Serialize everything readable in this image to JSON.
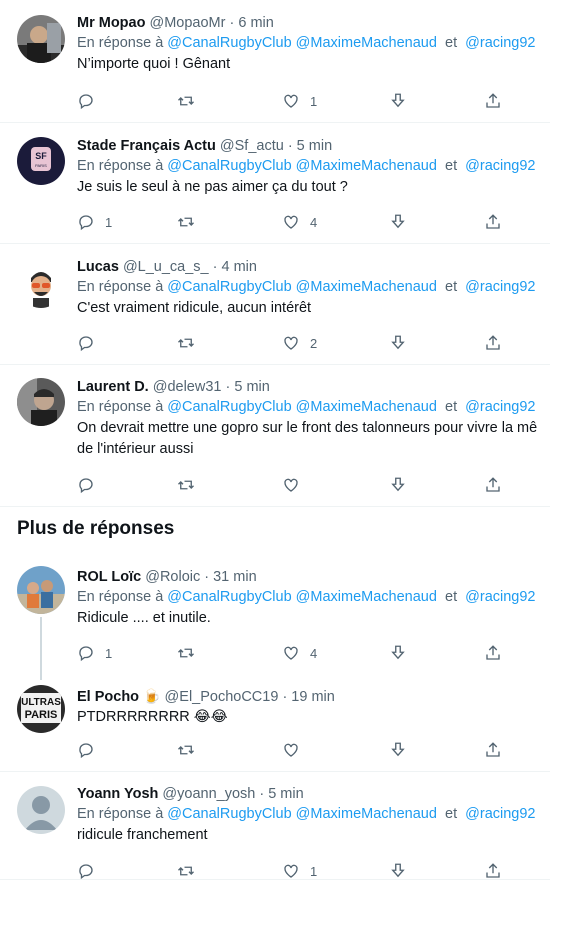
{
  "reply_prefix": "En réponse à",
  "and_word": "et",
  "section_title": "Plus de réponses",
  "tweets": [
    {
      "name": "Mr Mopao",
      "handle": "@MopaoMr",
      "time": "· 6 min",
      "mentions": [
        "@CanalRugbyClub",
        "@MaximeMachenaud",
        "@racing92"
      ],
      "lines": [
        "N’importe quoi ! Gênant"
      ],
      "replies": "",
      "retweets": "",
      "likes": "1"
    },
    {
      "name": "Stade Français Actu",
      "handle": "@Sf_actu",
      "time": "· 5 min",
      "mentions": [
        "@CanalRugbyClub",
        "@MaximeMachenaud",
        "@racing92"
      ],
      "lines": [
        "Je suis le seul à ne pas aimer ça du tout ?"
      ],
      "replies": "1",
      "retweets": "",
      "likes": "4"
    },
    {
      "name": "Lucas",
      "handle": "@L_u_ca_s_",
      "time": "· 4 min",
      "mentions": [
        "@CanalRugbyClub",
        "@MaximeMachenaud",
        "@racing92"
      ],
      "lines": [
        "C'est vraiment ridicule, aucun intérêt"
      ],
      "replies": "",
      "retweets": "",
      "likes": "2"
    },
    {
      "name": "Laurent D.",
      "handle": "@delew31",
      "time": "· 5 min",
      "mentions": [
        "@CanalRugbyClub",
        "@MaximeMachenaud",
        "@racing92"
      ],
      "lines": [
        "On devrait mettre une gopro sur le front des talonneurs pour vivre la mê",
        "de l'intérieur aussi"
      ],
      "replies": "",
      "retweets": "",
      "likes": ""
    },
    {
      "name": "ROL Loïc",
      "handle": "@Roloic",
      "time": "· 31 min",
      "mentions": [
        "@CanalRugbyClub",
        "@MaximeMachenaud",
        "@racing92"
      ],
      "lines": [
        "Ridicule .... et inutile."
      ],
      "replies": "1",
      "retweets": "",
      "likes": "4"
    },
    {
      "name": "El Pocho",
      "name_emoji": "🍺",
      "handle": "@El_PochoCC19",
      "time": "· 19 min",
      "mentions": [],
      "lines": [
        "PTDRRRRRRRR  😂😂"
      ],
      "replies": "",
      "retweets": "",
      "likes": ""
    },
    {
      "name": "Yoann Yosh",
      "handle": "@yoann_yosh",
      "time": "· 5 min",
      "mentions": [
        "@CanalRugbyClub",
        "@MaximeMachenaud",
        "@racing92"
      ],
      "lines": [
        "ridicule franchement"
      ],
      "replies": "",
      "retweets": "",
      "likes": "1"
    }
  ],
  "avatars": {
    "t0": "#6b6b6b",
    "t1": "#1a1a2e",
    "t2": "#f2f2f2",
    "t3": "#3a3a3a",
    "t4": "#5d87b0",
    "t5": "#2a2a2a",
    "t6": "#cfd9de"
  }
}
